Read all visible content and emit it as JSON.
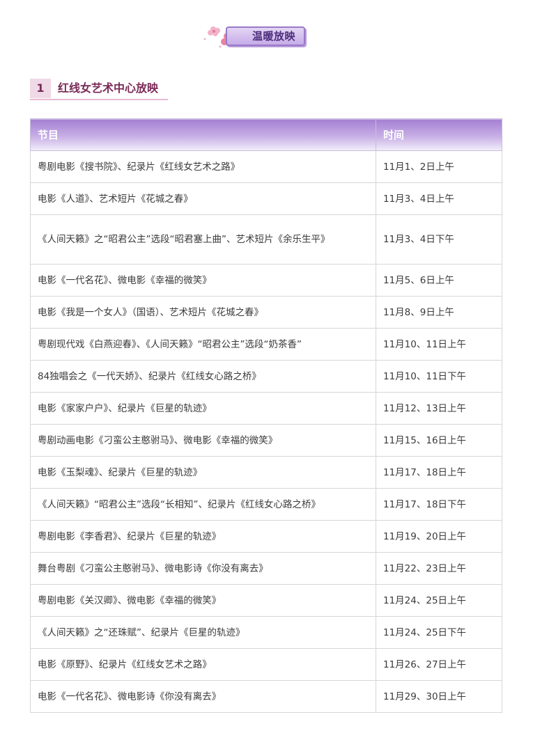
{
  "banner": {
    "label": "温暖放映"
  },
  "section": {
    "number": "1",
    "title": "红线女艺术中心放映"
  },
  "table": {
    "headers": [
      "节目",
      "时间"
    ],
    "rows": [
      {
        "program": "粤剧电影《搜书院》、纪录片《红线女艺术之路》",
        "time": "11月1、2日上午"
      },
      {
        "program": "电影《人道》、艺术短片《花城之春》",
        "time": "11月3、4日上午"
      },
      {
        "program": "《人间天籁》之“昭君公主”选段“昭君塞上曲”、艺术短片《余乐生平》",
        "time": "11月3、4日下午"
      },
      {
        "program": "电影《一代名花》、微电影《幸福的微笑》",
        "time": "11月5、6日上午"
      },
      {
        "program": "电影《我是一个女人》（国语）、艺术短片《花城之春》",
        "time": "11月8、9日上午"
      },
      {
        "program": "粤剧现代戏《白燕迎春》、《人间天籁》“昭君公主”选段“奶茶香”",
        "time": "11月10、11日上午"
      },
      {
        "program": "84独唱会之《一代天娇》、纪录片《红线女心路之桥》",
        "time": "11月10、11日下午"
      },
      {
        "program": "电影《家家户户》、纪录片《巨星的轨迹》",
        "time": "11月12、13日上午"
      },
      {
        "program": "粤剧动画电影《刁蛮公主憨驸马》、微电影《幸福的微笑》",
        "time": "11月15、16日上午"
      },
      {
        "program": "电影《玉梨魂》、纪录片《巨星的轨迹》",
        "time": "11月17、18日上午"
      },
      {
        "program": "《人间天籁》“昭君公主”选段“长相知”、纪录片《红线女心路之桥》",
        "time": "11月17、18日下午"
      },
      {
        "program": "粤剧电影《李香君》、纪录片《巨星的轨迹》",
        "time": "11月19、20日上午"
      },
      {
        "program": "舞台粤剧《刁蛮公主憨驸马》、微电影诗《你没有离去》",
        "time": "11月22、23日上午"
      },
      {
        "program": "粤剧电影《关汉卿》、微电影《幸福的微笑》",
        "time": "11月24、25日上午"
      },
      {
        "program": "《人间天籁》之“还珠赋”、纪录片《巨星的轨迹》",
        "time": "11月24、25日下午"
      },
      {
        "program": "电影《原野》、纪录片《红线女艺术之路》",
        "time": "11月26、27日上午"
      },
      {
        "program": "电影《一代名花》、微电影诗《你没有离去》",
        "time": "11月29、30日上午"
      }
    ]
  }
}
